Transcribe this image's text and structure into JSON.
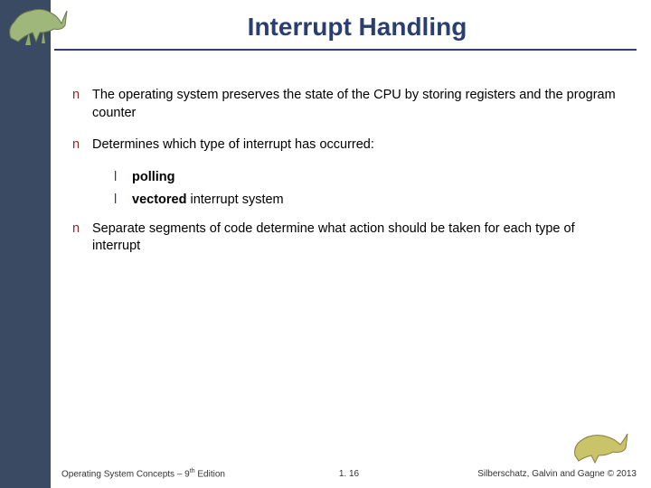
{
  "title": "Interrupt Handling",
  "bullets": {
    "b1": "The operating system preserves the state of the CPU by storing registers and the program counter",
    "b2": "Determines which type of interrupt has occurred:",
    "b2_sub1_bold": "polling",
    "b2_sub2_bold": "vectored",
    "b2_sub2_rest": " interrupt system",
    "b3": "Separate segments of code determine what action should be taken for each type of interrupt"
  },
  "footer": {
    "left_a": "Operating System Concepts – 9",
    "left_sup": "th",
    "left_b": " Edition",
    "center": "1. 16",
    "right": "Silberschatz, Galvin and Gagne © 2013"
  },
  "marks": {
    "n": "n",
    "l": "l"
  }
}
